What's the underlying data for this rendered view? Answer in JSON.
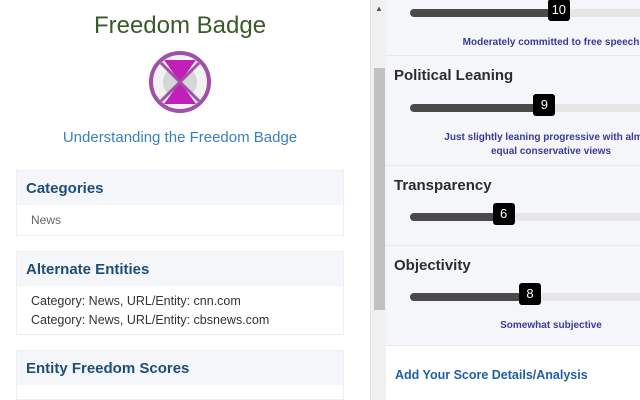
{
  "left": {
    "title": "Freedom Badge",
    "link": "Understanding the Freedom Badge",
    "categories": {
      "heading": "Categories",
      "items": [
        "News"
      ]
    },
    "alternate": {
      "heading": "Alternate Entities",
      "rows": [
        "Category: News, URL/Entity: cnn.com",
        "Category: News, URL/Entity: cbsnews.com"
      ]
    },
    "scores": {
      "heading": "Entity Freedom Scores"
    }
  },
  "right": {
    "top_slider": {
      "value": "10",
      "fill_fraction": 0.62,
      "caption": "Moderately committed to free speech"
    },
    "political": {
      "title": "Political Leaning",
      "value": "9",
      "fill_fraction": 0.56,
      "caption_line1": "Just slightly leaning progressive with almost",
      "caption_line2": "equal conservative views"
    },
    "transparency": {
      "title": "Transparency",
      "value": "6",
      "fill_fraction": 0.39
    },
    "objectivity": {
      "title": "Objectivity",
      "value": "8",
      "fill_fraction": 0.5,
      "caption": "Somewhat subjective"
    },
    "add_link": "Add Your Score Details/Analysis"
  },
  "colors": {
    "title_green": "#3a5a2a",
    "link_blue": "#3a7fc0",
    "heading_blue": "#1e4e78",
    "logo_purple": "#a050a8",
    "logo_magenta": "#c020b8",
    "caption_indigo": "#3a3a9a"
  },
  "icons": {
    "logo": "freedom-badge-logo",
    "scroll_up": "scroll-up-arrow-icon"
  }
}
